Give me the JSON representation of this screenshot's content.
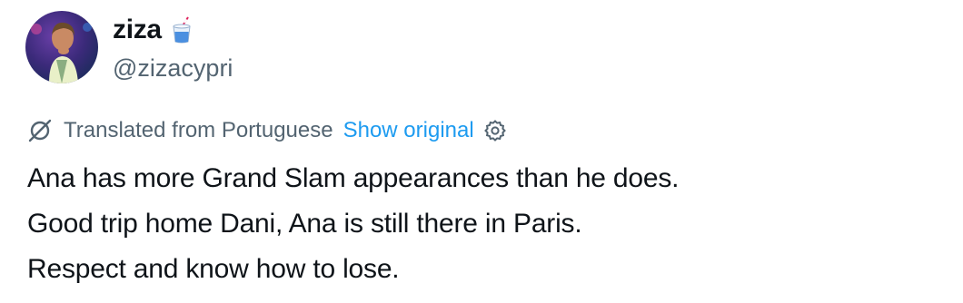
{
  "author": {
    "display_name": "ziza",
    "handle": "@zizacypri",
    "avatar_icon": "profile-photo",
    "name_emoji_icon": "drink-with-straw-icon"
  },
  "translation": {
    "label": "Translated from Portuguese",
    "show_original": "Show original",
    "translate_icon": "translate-icon",
    "settings_icon": "gear-icon"
  },
  "tweet": {
    "lines": [
      "Ana has more Grand Slam appearances than he does.",
      "Good trip home Dani, Ana is still there in Paris.",
      "Respect and know how to lose."
    ]
  },
  "colors": {
    "text_primary": "#0f1419",
    "text_secondary": "#536471",
    "link": "#1d9bf0"
  }
}
